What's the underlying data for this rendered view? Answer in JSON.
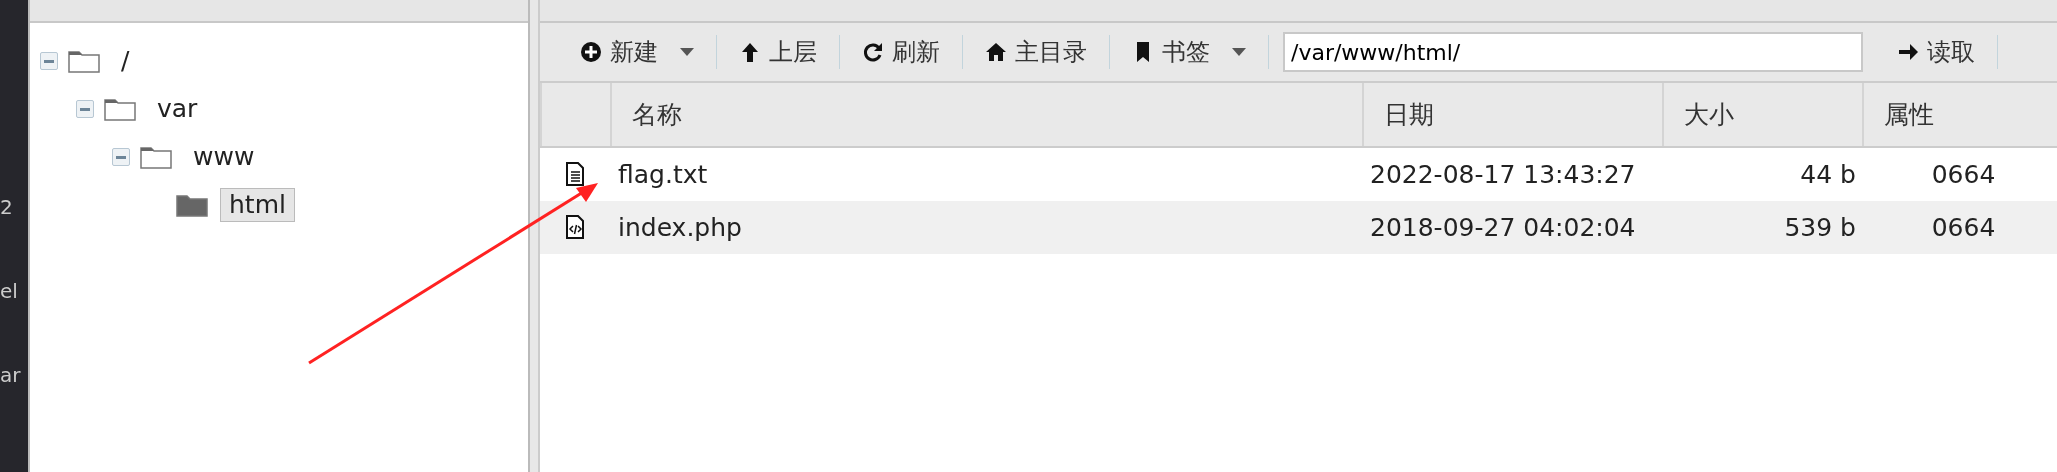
{
  "background_app": {
    "fragments": [
      "2",
      "el",
      "ar"
    ]
  },
  "directory_tree": {
    "nodes": [
      {
        "label": "/",
        "expanded": true,
        "selected": false,
        "children": [
          {
            "label": "var",
            "expanded": true,
            "selected": false,
            "children": [
              {
                "label": "www",
                "expanded": true,
                "selected": false,
                "children": [
                  {
                    "label": "html",
                    "expanded": false,
                    "selected": true
                  }
                ]
              }
            ]
          }
        ]
      }
    ]
  },
  "toolbar": {
    "buttons": [
      {
        "label": "新建",
        "dropdown": true
      },
      {
        "label": "上层",
        "dropdown": false
      },
      {
        "label": "刷新",
        "dropdown": false
      },
      {
        "label": "主目录",
        "dropdown": false
      },
      {
        "label": "书签",
        "dropdown": true
      }
    ],
    "path": {
      "value": "/var/www/html/"
    },
    "read_button": {
      "label": "读取"
    }
  },
  "file_table": {
    "columns": [
      "名称",
      "日期",
      "大小",
      "属性"
    ],
    "rows": [
      {
        "kind": "text",
        "name": "flag.txt",
        "date": "2022-08-17 13:43:27",
        "size": "44 b",
        "attributes": "0664"
      },
      {
        "kind": "code",
        "name": "index.php",
        "date": "2018-09-27 04:02:04",
        "size": "539 b",
        "attributes": "0664"
      }
    ]
  }
}
